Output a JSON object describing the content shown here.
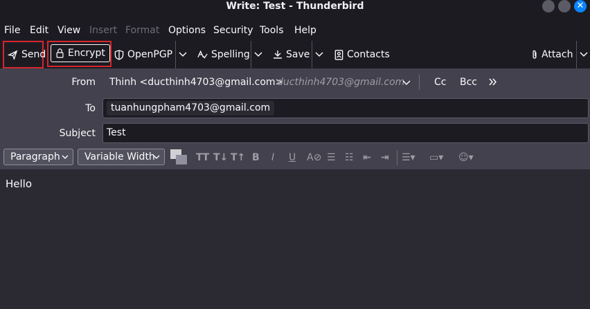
{
  "window": {
    "title": "Write: Test - Thunderbird",
    "close_glyph": "✕"
  },
  "menu": {
    "file": "File",
    "edit": "Edit",
    "view": "View",
    "insert": "Insert",
    "format": "Format",
    "options": "Options",
    "security": "Security",
    "tools": "Tools",
    "help": "Help"
  },
  "toolbar": {
    "send": "Send",
    "encrypt": "Encrypt",
    "openpgp": "OpenPGP",
    "spelling": "Spelling",
    "save": "Save",
    "contacts": "Contacts",
    "attach": "Attach"
  },
  "header": {
    "from_label": "From",
    "from_value": "Thinh <ducthinh4703@gmail.com>",
    "from_identity": "ducthinh4703@gmail.com",
    "cc": "Cc",
    "bcc": "Bcc",
    "to_label": "To",
    "to_recipient": "tuanhungpham4703@gmail.com",
    "subject_label": "Subject",
    "subject_value": "Test"
  },
  "format_bar": {
    "paragraph": "Paragraph",
    "font": "Variable Width"
  },
  "body": {
    "text": "Hello"
  },
  "colors": {
    "highlight": "#d7262e",
    "accent": "#0a84ff"
  }
}
